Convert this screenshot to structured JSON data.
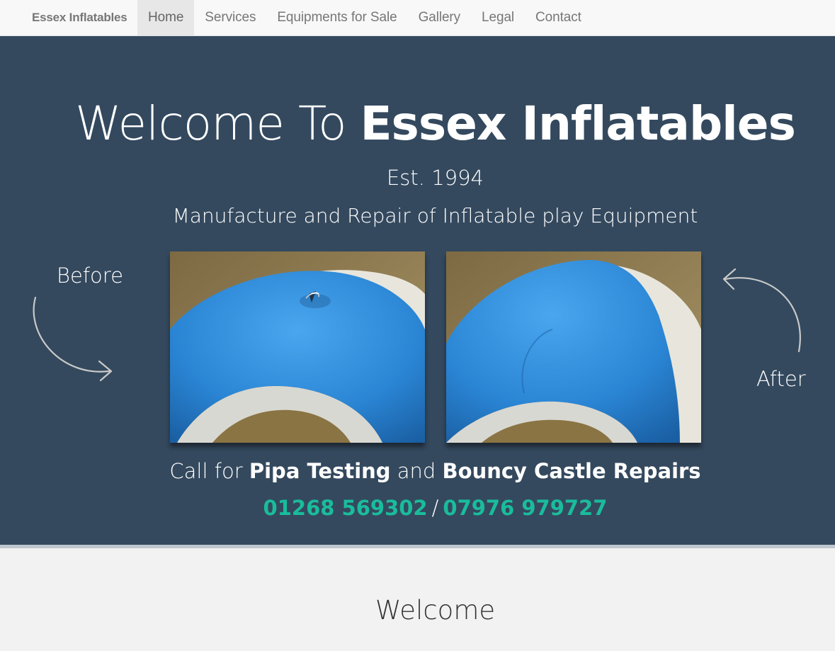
{
  "navbar": {
    "brand": "Essex Inflatables",
    "items": [
      {
        "label": "Home",
        "active": true
      },
      {
        "label": "Services"
      },
      {
        "label": "Equipments for Sale"
      },
      {
        "label": "Gallery"
      },
      {
        "label": "Legal"
      },
      {
        "label": "Contact"
      }
    ]
  },
  "hero": {
    "title_light": "Welcome To ",
    "title_bold": "Essex Inflatables",
    "established": "Est. 1994",
    "tagline": "Manufacture and Repair of Inflatable play Equipment",
    "before_label": "Before",
    "after_label": "After",
    "cta": {
      "prefix": "Call for ",
      "service1": "Pipa Testing",
      "joiner": " and ",
      "service2": "Bouncy Castle Repairs"
    },
    "phones": {
      "phone1": "01268 569302",
      "separator": "/",
      "phone2": "07976 979727"
    }
  },
  "welcome_heading": "Welcome",
  "colors": {
    "navbar_bg": "#f8f8f8",
    "hero_bg": "#34495e",
    "phone_accent": "#1abc9c",
    "page_bg": "#f2f2f2",
    "inflatable_blue": "#2a85d4"
  }
}
